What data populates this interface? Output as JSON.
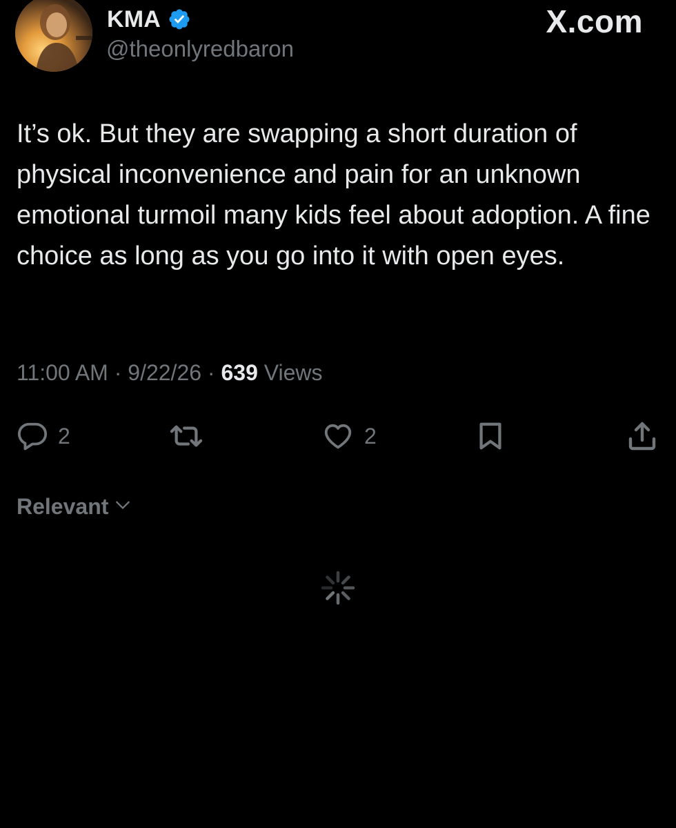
{
  "header": {
    "display_name": "KMA",
    "handle": "@theonlyredbaron",
    "site_brand": "X.com",
    "verified_icon": "verified-badge-icon",
    "verified_color": "#1d9bf0"
  },
  "tweet": {
    "text": "It’s ok. But they are swapping a short duration of physical inconvenience and pain for an unknown emotional turmoil many kids feel about adoption. A fine choice as long as you go into it with open eyes.",
    "time": "11:00 AM",
    "date": "9/22/26",
    "separator": "·",
    "views_count": "639",
    "views_label": "Views"
  },
  "actions": {
    "reply_icon": "reply-icon",
    "reply_count": "2",
    "retweet_icon": "retweet-icon",
    "like_icon": "heart-icon",
    "like_count": "2",
    "bookmark_icon": "bookmark-icon",
    "share_icon": "share-icon"
  },
  "replies": {
    "sort_label": "Relevant",
    "sort_icon": "chevron-down-icon",
    "loading_icon": "spinner-icon"
  },
  "colors": {
    "background": "#000000",
    "primary_text": "#e7e9ea",
    "secondary_text": "#71767b",
    "accent": "#1d9bf0"
  }
}
